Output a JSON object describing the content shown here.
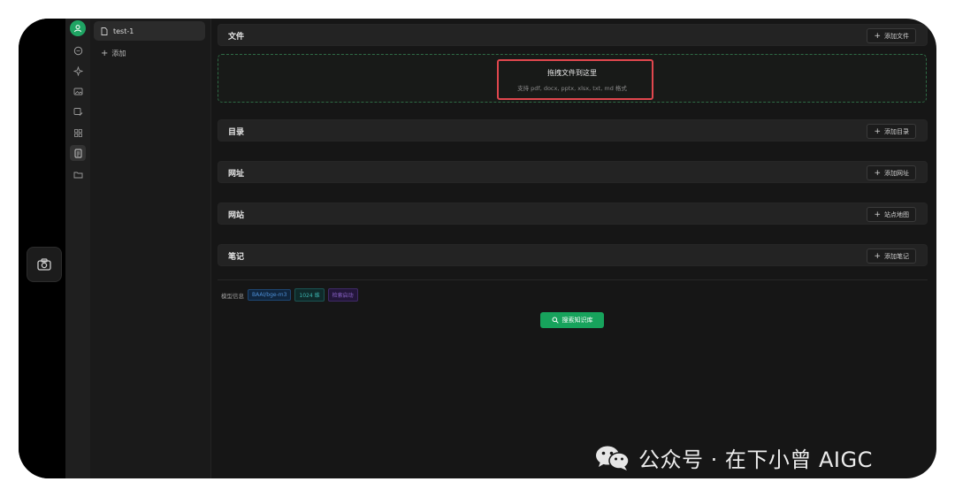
{
  "sidebar": {
    "kb_items": [
      {
        "label": "test-1"
      }
    ],
    "add_label": "添加"
  },
  "icon_bar": {
    "icons": [
      "user-avatar-icon",
      "chat-icon",
      "sparkle-icon",
      "image-icon",
      "image-edit-icon",
      "grid-icon",
      "knowledge-base-icon",
      "folder-icon"
    ]
  },
  "sections": {
    "files": {
      "title": "文件",
      "action": "添加文件"
    },
    "directory": {
      "title": "目录",
      "action": "添加目录"
    },
    "url": {
      "title": "网址",
      "action": "添加网址"
    },
    "website": {
      "title": "网站",
      "action": "站点地图"
    },
    "notes": {
      "title": "笔记",
      "action": "添加笔记"
    }
  },
  "dropzone": {
    "title": "拖拽文件到这里",
    "subtitle": "支持 pdf, docx, pptx, xlsx, txt, md 格式"
  },
  "model_info": {
    "label": "模型信息",
    "tags": [
      "BAAI/bge-m3",
      "1024 维",
      "检索启动"
    ]
  },
  "search_button": "搜索知识库",
  "watermark": "公众号 · 在下小曾 AIGC",
  "colors": {
    "accent_green": "#17a35c",
    "highlight_red": "#e0474e",
    "background": "#161616"
  }
}
